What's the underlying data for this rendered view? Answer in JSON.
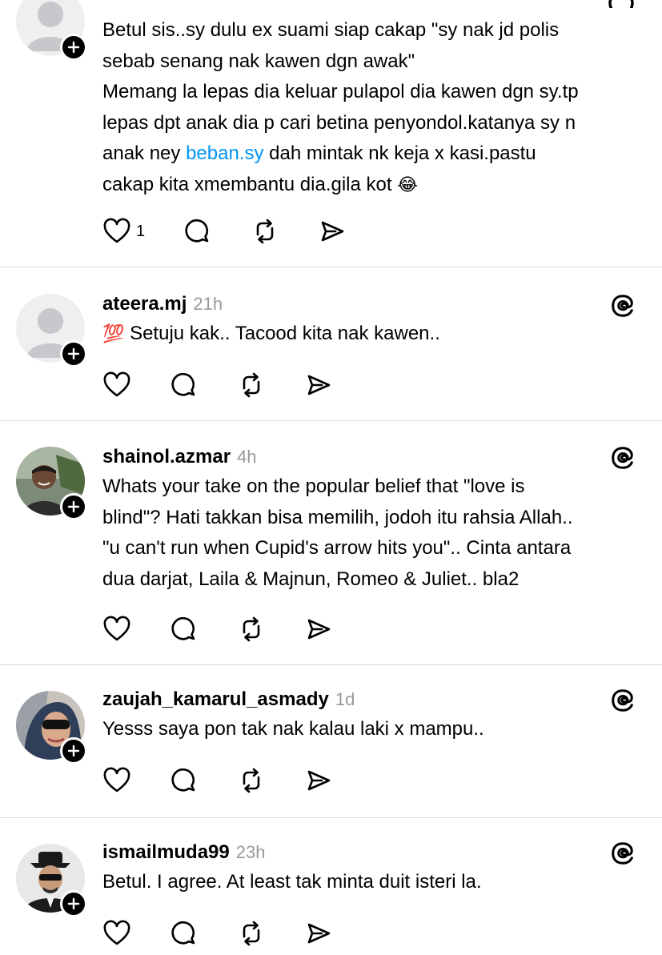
{
  "icons": {
    "like": "heart-icon",
    "reply": "comment-bubble-icon",
    "repost": "repost-icon",
    "share": "send-icon",
    "follow": "plus-icon",
    "app": "threads-logo-icon"
  },
  "colors": {
    "link": "#0095f6",
    "timestamp": "#999999",
    "divider": "#dbdbdb"
  },
  "posts": [
    {
      "username": "",
      "time": "",
      "lines": [
        "Betul sis..sy dulu ex suami siap cakap \"sy nak jd polis",
        "sebab senang nak kawen dgn awak\"",
        "Memang la lepas dia keluar pulapol dia kawen dgn sy.tp",
        "lepas dpt anak dia p cari betina penyondol.katanya sy n"
      ],
      "line5_before": "anak ney ",
      "line5_link": "beban.sy",
      "line5_after": " dah mintak nk keja x kasi.pastu",
      "line6": "cakap kita xmembantu dia.gila kot",
      "line6_emoji": "😂",
      "like_count": "1"
    },
    {
      "username": "ateera.mj",
      "time": "21h",
      "emoji": "💯",
      "text": "Setuju kak.. Tacood kita nak kawen.."
    },
    {
      "username": "shainol.azmar",
      "time": "4h",
      "lines": [
        "Whats your take on the popular belief that \"love is",
        "blind\"? Hati takkan bisa memilih, jodoh itu rahsia Allah..",
        "\"u can't run when Cupid's arrow hits you\".. Cinta antara",
        "dua darjat, Laila & Majnun, Romeo & Juliet.. bla2"
      ]
    },
    {
      "username": "zaujah_kamarul_asmady",
      "time": "1d",
      "text": "Yesss saya pon tak nak kalau laki x mampu.."
    },
    {
      "username": "ismailmuda99",
      "time": "23h",
      "text": "Betul. I agree. At least tak minta duit isteri la."
    }
  ]
}
